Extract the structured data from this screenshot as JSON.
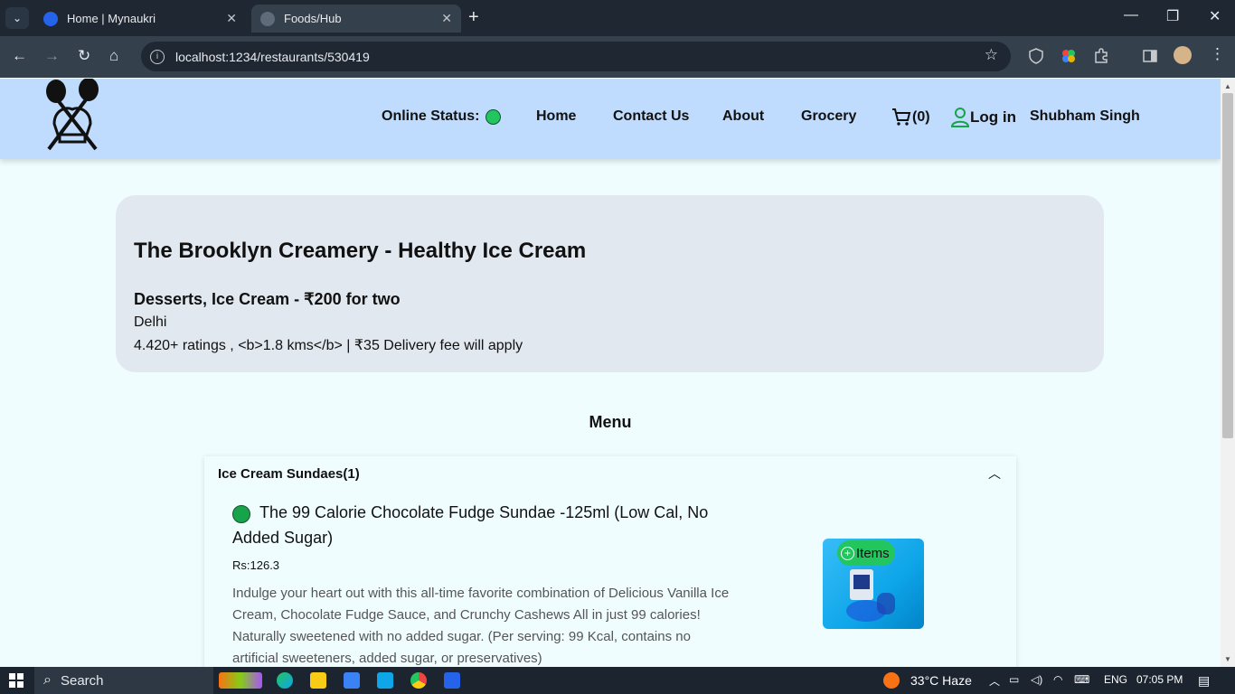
{
  "browser": {
    "tabs": [
      {
        "title": "Home | Mynaukri",
        "active": false
      },
      {
        "title": "Foods/Hub",
        "active": true
      }
    ],
    "url": "localhost:1234/restaurants/530419"
  },
  "header": {
    "online_status_label": "Online Status:",
    "nav": [
      "Home",
      "Contact Us",
      "About",
      "Grocery"
    ],
    "cart_count": "(0)",
    "login_label": "Log in",
    "user_name": "Shubham Singh",
    "status_color": "#22c55e"
  },
  "restaurant": {
    "name": "The Brooklyn Creamery - Healthy Ice Cream",
    "cuisine_price": "Desserts, Ice Cream - ₹200 for two",
    "area": "Delhi",
    "rating_line": "4.420+ ratings , <b>1.8 kms</b> | ₹35 Delivery fee will apply"
  },
  "menu": {
    "title": "Menu",
    "category": {
      "title": "Ice Cream Sundaes(1)",
      "item": {
        "name": "The 99 Calorie Chocolate Fudge Sundae -125ml (Low Cal, No Added Sugar)",
        "price": "Rs:126.3",
        "description": "Indulge your heart out with this all-time favorite combination of Delicious Vanilla Ice Cream, Chocolate Fudge Sauce, and Crunchy Cashews All in just 99 calories! Naturally sweetened with no added sugar. (Per serving: 99 Kcal, contains no artificial sweeteners, added sugar, or preservatives)",
        "add_label": "Items"
      }
    }
  },
  "taskbar": {
    "search_label": "Search",
    "weather": "33°C  Haze",
    "language": "ENG",
    "time": "07:05 PM"
  }
}
